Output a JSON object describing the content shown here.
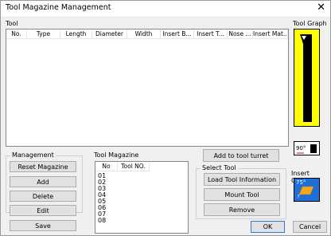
{
  "window": {
    "title": "Tool Magazine Management",
    "close_symbol": "✕"
  },
  "tool_section": {
    "label": "Tool",
    "columns": [
      "No.",
      "Type",
      "Length",
      "Diameter",
      "Width",
      "Insert B...",
      "Insert T...",
      "Nose ...",
      "Insert Mat..."
    ]
  },
  "tool_graph": {
    "label": "Tool Graph",
    "angle_label": "90°",
    "bg_color": "#ffff00"
  },
  "insert_graph": {
    "label": "Insert Graph",
    "angle_label": "75°",
    "corner_label": "r",
    "bg_color": "#1e6fd9",
    "insert_color": "#f5a623"
  },
  "management": {
    "label": "Management",
    "buttons": {
      "reset": "Reset Magazine",
      "add": "Add",
      "delete": "Delete",
      "edit": "Edit",
      "save": "Save"
    }
  },
  "magazine": {
    "label": "Tool Magazine",
    "columns": [
      "No",
      "Tool NO."
    ],
    "rows": [
      "01",
      "02",
      "03",
      "04",
      "05",
      "06",
      "07",
      "08"
    ]
  },
  "add_to_turret": "Add to tool turret",
  "select_tool": {
    "label": "Select Tool",
    "buttons": {
      "load": "Load Tool Information",
      "mount": "Mount Tool",
      "remove": "Remove"
    }
  },
  "dialog": {
    "ok": "OK",
    "cancel": "Cancel"
  }
}
